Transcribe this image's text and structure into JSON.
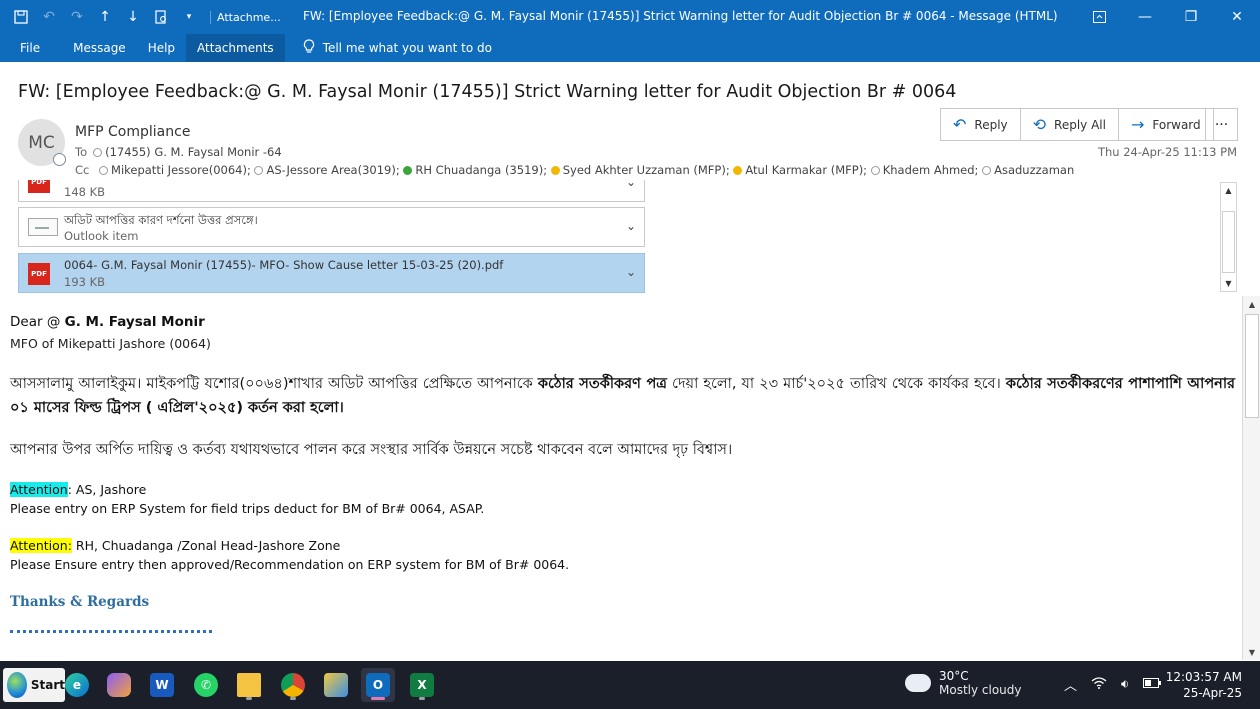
{
  "window": {
    "attachments_crumb": "Attachme...",
    "title": "FW: [Employee Feedback:@ G. M. Faysal Monir (17455)] Strict Warning letter for Audit Objection Br # 0064  -  Message (HTML)"
  },
  "menu": {
    "items": [
      "File",
      "Message",
      "Help",
      "Attachments"
    ],
    "tell_me": "Tell me what you want to do"
  },
  "message": {
    "subject": "FW: [Employee Feedback:@ G. M. Faysal Monir (17455)] Strict Warning letter for Audit Objection Br # 0064",
    "avatar_initials": "MC",
    "sender": "MFP Compliance",
    "to_label": "To",
    "to": "(17455) G. M. Faysal Monir   -64",
    "cc_label": "Cc",
    "cc": [
      {
        "name": "Mikepatti Jessore(0064);",
        "status": "none"
      },
      {
        "name": "AS-Jessore Area(3019);",
        "status": "none"
      },
      {
        "name": "RH Chuadanga (3519);",
        "status": "available"
      },
      {
        "name": "Syed Akhter Uzzaman (MFP);",
        "status": "away"
      },
      {
        "name": "Atul  Karmakar (MFP);",
        "status": "away"
      },
      {
        "name": "Khadem Ahmed;",
        "status": "none"
      },
      {
        "name": "Asaduzzaman",
        "status": "none"
      }
    ],
    "datetime": "Thu 24-Apr-25 11:13 PM",
    "actions": {
      "reply": "Reply",
      "reply_all": "Reply All",
      "forward": "Forward",
      "more": "···"
    }
  },
  "attachments": [
    {
      "name": "",
      "size": "148 KB",
      "type": "pdf"
    },
    {
      "name": "অডিট আপত্তির কারণ দর্শনো উত্তর প্রসঙ্গে।",
      "size": "Outlook item",
      "type": "mail"
    },
    {
      "name": "0064- G.M. Faysal Monir (17455)- MFO- Show Cause letter 15-03-25 (20).pdf",
      "size": "193 KB",
      "type": "pdf"
    }
  ],
  "body": {
    "greeting_prefix": "Dear  @ ",
    "greeting_name": "G. M. Faysal Monir",
    "mfo_line": "MFO of Mikepatti Jashore (0064)",
    "para1_a": "আসসালামু আলাইকুম। মাইকপট্টি যশোর(০০৬৪)শাখার অডিট আপত্তির প্রেক্ষিতে আপনাকে ",
    "para1_b": "কঠোর সতর্কীকরণ পত্র",
    "para1_c": " দেয়া হলো, যা ২৩ মার্চ'২০২৫ তারিখ থেকে কার্যকর হবে। ",
    "para1_d": "কঠোর সতর্কীকরণের পাশাপাশি আপনার ০১ মাসের ফিল্ড ট্রিপস ( এপ্রিল'২০২৫) কর্তন করা হলো।",
    "para2": "আপনার উপর অর্পিত দায়িত্ব ও কর্তব্য যথাযথভাবে পালন করে সংস্থার সার্বিক উন্নয়নে সচেষ্ট থাকবেন বলে আমাদের দৃঢ় বিশ্বাস।",
    "attention1_label": "Attention",
    "attention1_rest": ": AS, Jashore",
    "attention1_line2": "Please entry on ERP System for field trips deduct for BM of Br# 0064, ASAP.",
    "attention2_label": "Attention:",
    "attention2_rest": " RH, Chuadanga /Zonal Head-Jashore Zone",
    "attention2_line2": "Please Ensure entry then approved/Recommendation on ERP system for BM of Br# 0064.",
    "thanks": "Thanks & Regards"
  },
  "taskbar": {
    "start": "Start",
    "weather_temp": "30°C",
    "weather_desc": "Mostly cloudy",
    "time": "12:03:57 AM",
    "date": "25-Apr-25"
  },
  "colors": {
    "accent": "#0f6cbd",
    "attention1_highlight": "#19ebeb",
    "attention2_highlight": "#ffff00",
    "signature": "#2e6e9e"
  }
}
